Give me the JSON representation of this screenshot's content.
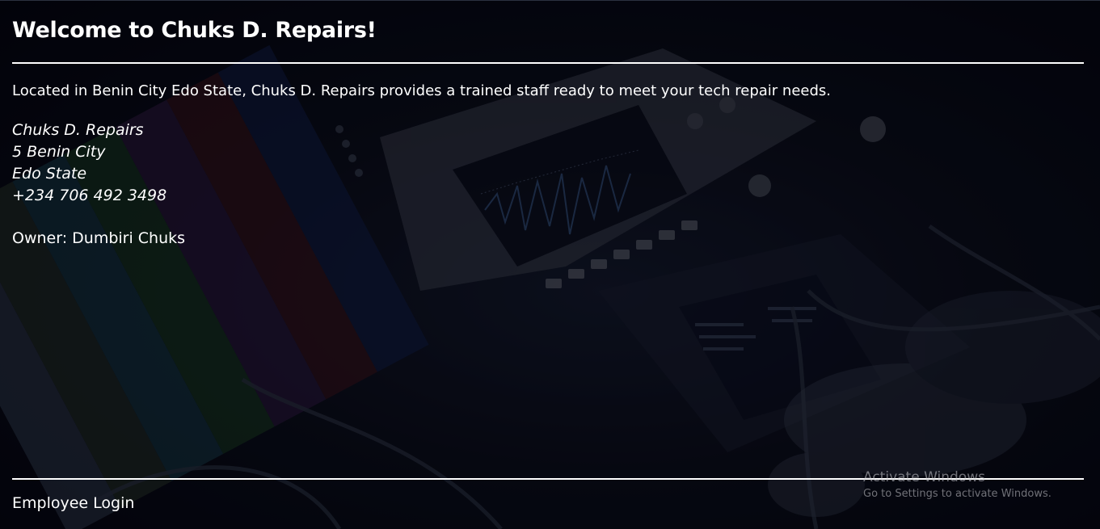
{
  "header": {
    "title": "Welcome to Chuks D. Repairs!"
  },
  "intro": "Located in Benin City Edo State, Chuks D. Repairs provides a trained staff ready to meet your tech repair needs.",
  "address": {
    "business": "Chuks D. Repairs",
    "street": "5 Benin City",
    "state": "Edo State",
    "phone": "+234 706 492 3498"
  },
  "owner": "Owner: Dumbiri Chuks",
  "footer": {
    "employee_login": "Employee Login"
  },
  "watermark": {
    "title": "Activate Windows",
    "subtitle": "Go to Settings to activate Windows."
  },
  "icons": {
    "background": "electronics-repair-photo"
  },
  "colors": {
    "background": "#05070c",
    "text": "#ffffff",
    "rule": "#ffffff"
  }
}
